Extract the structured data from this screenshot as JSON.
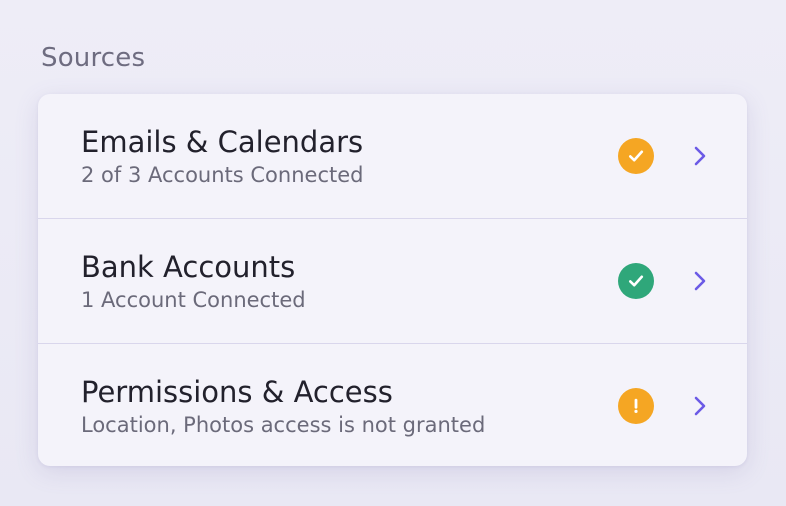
{
  "section": {
    "title": "Sources"
  },
  "colors": {
    "warning": "#f5a623",
    "success": "#2fa77a",
    "accent": "#6b5ae6"
  },
  "sources": [
    {
      "title": "Emails & Calendars",
      "subtitle": "2 of 3 Accounts Connected",
      "status": "warning",
      "status_icon": "check-icon",
      "action_icon": "chevron-right-icon"
    },
    {
      "title": "Bank Accounts",
      "subtitle": "1 Account Connected",
      "status": "success",
      "status_icon": "check-icon",
      "action_icon": "chevron-right-icon"
    },
    {
      "title": "Permissions & Access",
      "subtitle": "Location, Photos access is not granted",
      "status": "warning",
      "status_icon": "exclamation-icon",
      "action_icon": "chevron-right-icon"
    }
  ]
}
